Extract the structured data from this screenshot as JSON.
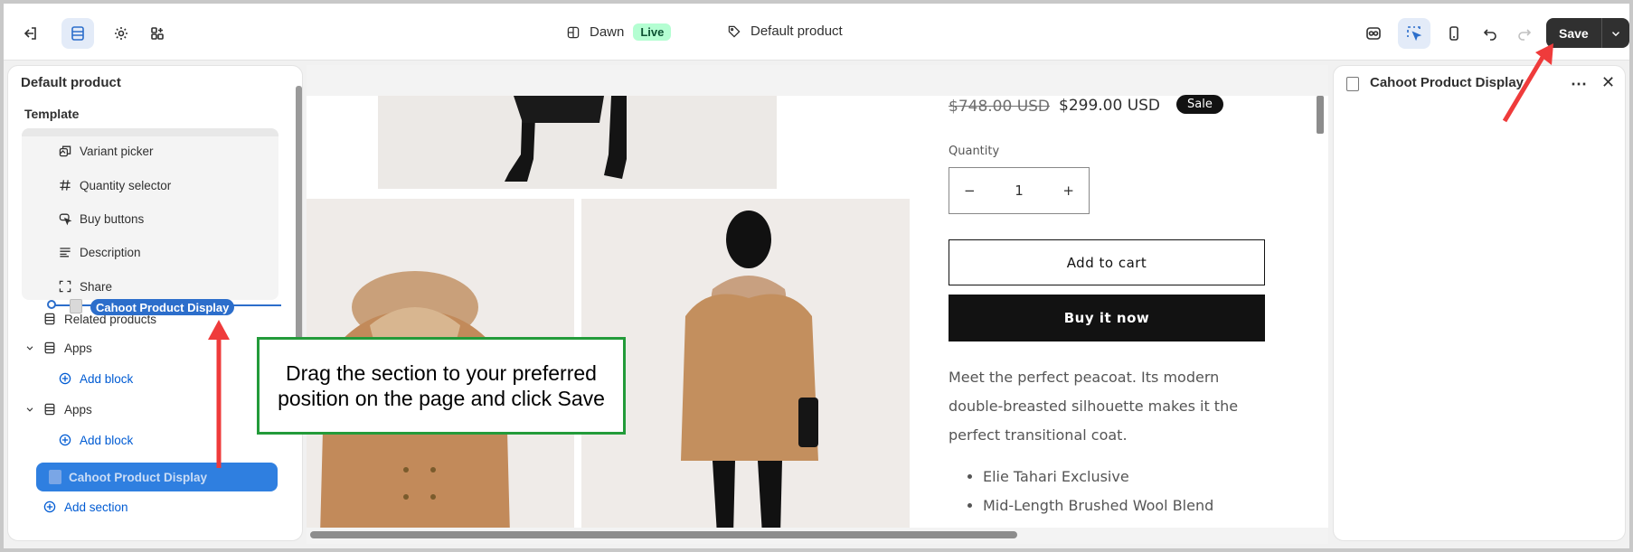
{
  "header": {
    "theme_name": "Dawn",
    "theme_status": "Live",
    "template_name": "Default product",
    "save_label": "Save"
  },
  "sidebar": {
    "title": "Default product",
    "section_label": "Template",
    "blocks": [
      {
        "label": "Variant picker",
        "icon": "variant-picker-icon"
      },
      {
        "label": "Quantity selector",
        "icon": "hash-icon"
      },
      {
        "label": "Buy buttons",
        "icon": "cursor-click-icon"
      },
      {
        "label": "Description",
        "icon": "text-lines-icon"
      },
      {
        "label": "Share",
        "icon": "share-frame-icon"
      }
    ],
    "dragging_label": "Cahoot Product Display",
    "related_label": "Related products",
    "apps": [
      {
        "label": "Apps",
        "add_block": "Add block"
      },
      {
        "label": "Apps",
        "add_block": "Add block"
      }
    ],
    "selected_label": "Cahoot Product Display",
    "add_section": "Add section"
  },
  "product": {
    "compare_price": "$748.00 USD",
    "price": "$299.00 USD",
    "sale_badge": "Sale",
    "quantity_label": "Quantity",
    "quantity_value": "1",
    "minus": "−",
    "plus": "+",
    "add_to_cart": "Add to cart",
    "buy_now": "Buy it now",
    "description": "Meet the perfect peacoat. Its modern double-breasted silhouette makes it the perfect transitional coat.",
    "bullets": [
      "Elie Tahari Exclusive",
      "Mid-Length Brushed Wool Blend"
    ]
  },
  "right_panel": {
    "title": "Cahoot Product Display"
  },
  "annotation": {
    "callout_line1": "Drag the section to your preferred",
    "callout_line2": "position on the page and click Save",
    "arrow_color": "#ef3b3b",
    "callout_border_color": "#239b3a"
  },
  "colors": {
    "accent_blue": "#2c6ecb",
    "live_badge_bg": "#b4fed2",
    "save_bg": "#303030"
  }
}
